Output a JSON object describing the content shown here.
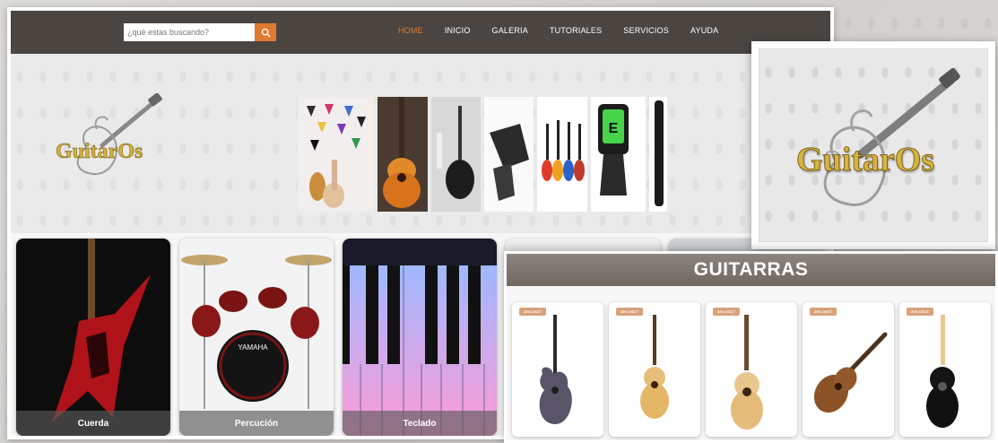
{
  "search": {
    "placeholder": "¿qué estas buscando?"
  },
  "nav": {
    "items": [
      {
        "label": "HOME",
        "active": true
      },
      {
        "label": "INICIO",
        "active": false
      },
      {
        "label": "GALERIA",
        "active": false
      },
      {
        "label": "TUTORIALES",
        "active": false
      },
      {
        "label": "SERVICIOS",
        "active": false
      },
      {
        "label": "AYUDA",
        "active": false
      }
    ]
  },
  "brand": {
    "logo_text": "GuitarOs"
  },
  "categories": [
    {
      "label": "Cuerda"
    },
    {
      "label": "Percución"
    },
    {
      "label": "Teclado"
    }
  ],
  "guitarras": {
    "title": "GUITARRAS",
    "badge": "20% DSCT",
    "items": [
      {
        "name": "guitar-1",
        "badge": "20% DSCT"
      },
      {
        "name": "guitar-2",
        "badge": "20% DSCT"
      },
      {
        "name": "guitar-3",
        "badge": "20% DSCT"
      },
      {
        "name": "guitar-4",
        "badge": "20% DSCT"
      },
      {
        "name": "guitar-5",
        "badge": "20% DSCT"
      }
    ]
  },
  "colors": {
    "navbar": "#4a4541",
    "accent": "#e07a2e",
    "header_band": "#7a736c"
  }
}
